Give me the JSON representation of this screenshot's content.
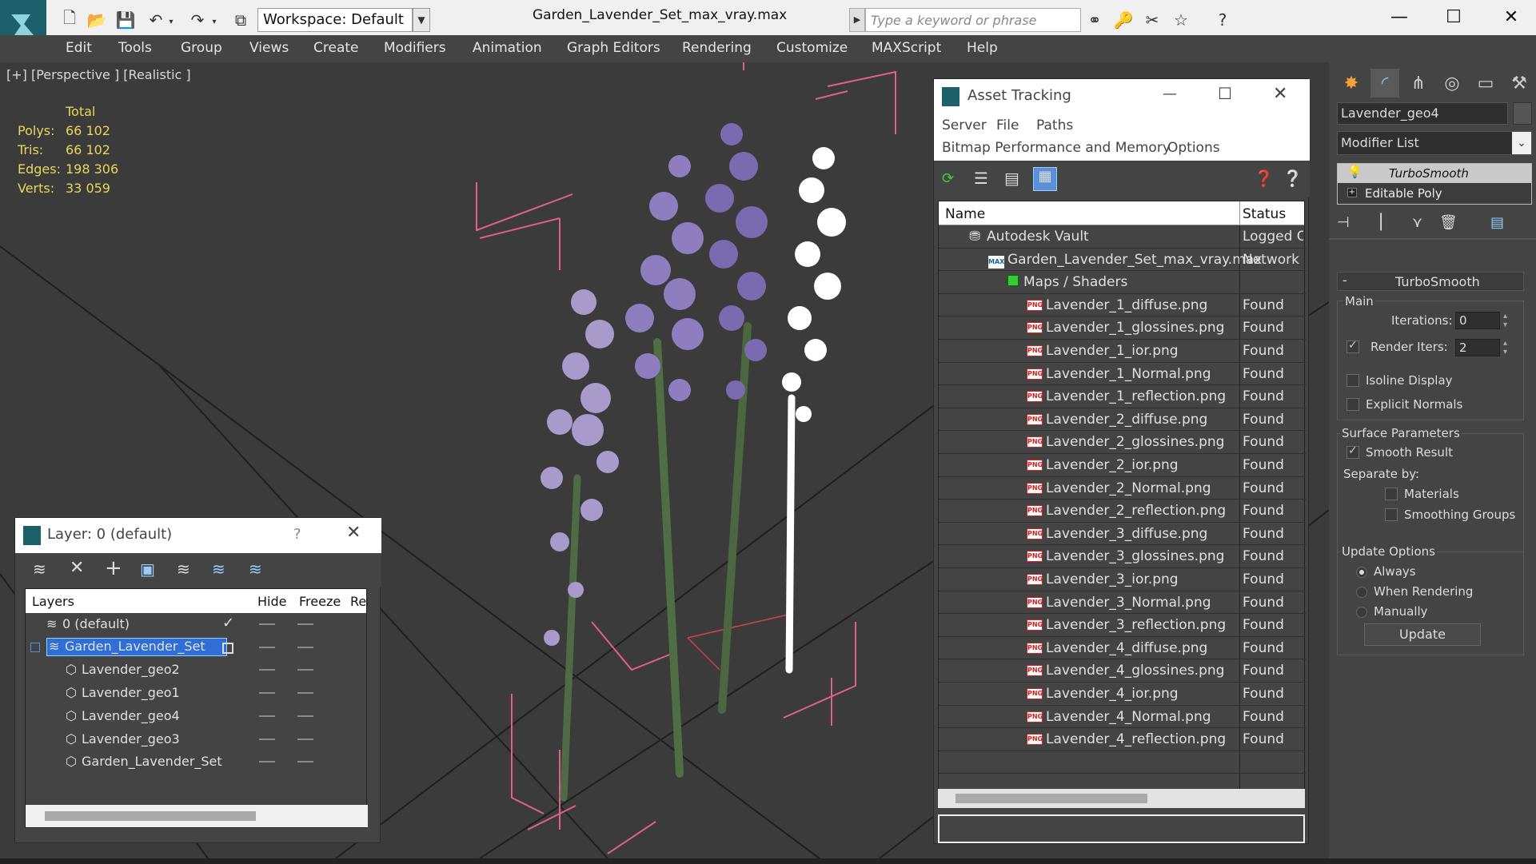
{
  "titlebar": {
    "workspace": "Workspace: Default",
    "document_title": "Garden_Lavender_Set_max_vray.max",
    "search_placeholder": "Type a keyword or phrase"
  },
  "menu": [
    "Edit",
    "Tools",
    "Group",
    "Views",
    "Create",
    "Modifiers",
    "Animation",
    "Graph Editors",
    "Rendering",
    "Customize",
    "MAXScript",
    "Help"
  ],
  "viewport": {
    "label": "[+] [Perspective ] [Realistic ]",
    "stats_header": "Total",
    "stats": [
      {
        "label": "Polys:",
        "value": "66 102"
      },
      {
        "label": "Tris:",
        "value": "66 102"
      },
      {
        "label": "Edges:",
        "value": "198 306"
      },
      {
        "label": "Verts:",
        "value": "33 059"
      }
    ]
  },
  "asset_tracking": {
    "title": "Asset Tracking",
    "menu": [
      "Server",
      "File",
      "Paths",
      "Bitmap Performance and Memory",
      "Options"
    ],
    "columns": [
      "Name",
      "Status"
    ],
    "rows": [
      {
        "name": "Autodesk Vault",
        "status": "Logged Out",
        "indent": 0,
        "icon": "vault"
      },
      {
        "name": "Garden_Lavender_Set_max_vray.max",
        "status": "Network",
        "indent": 1,
        "icon": "max"
      },
      {
        "name": "Maps / Shaders",
        "status": "",
        "indent": 2,
        "icon": "maps"
      },
      {
        "name": "Lavender_1_diffuse.png",
        "status": "Found",
        "indent": 3,
        "icon": "png"
      },
      {
        "name": "Lavender_1_glossines.png",
        "status": "Found",
        "indent": 3,
        "icon": "png"
      },
      {
        "name": "Lavender_1_ior.png",
        "status": "Found",
        "indent": 3,
        "icon": "png"
      },
      {
        "name": "Lavender_1_Normal.png",
        "status": "Found",
        "indent": 3,
        "icon": "png"
      },
      {
        "name": "Lavender_1_reflection.png",
        "status": "Found",
        "indent": 3,
        "icon": "png"
      },
      {
        "name": "Lavender_2_diffuse.png",
        "status": "Found",
        "indent": 3,
        "icon": "png"
      },
      {
        "name": "Lavender_2_glossines.png",
        "status": "Found",
        "indent": 3,
        "icon": "png"
      },
      {
        "name": "Lavender_2_ior.png",
        "status": "Found",
        "indent": 3,
        "icon": "png"
      },
      {
        "name": "Lavender_2_Normal.png",
        "status": "Found",
        "indent": 3,
        "icon": "png"
      },
      {
        "name": "Lavender_2_reflection.png",
        "status": "Found",
        "indent": 3,
        "icon": "png"
      },
      {
        "name": "Lavender_3_diffuse.png",
        "status": "Found",
        "indent": 3,
        "icon": "png"
      },
      {
        "name": "Lavender_3_glossines.png",
        "status": "Found",
        "indent": 3,
        "icon": "png"
      },
      {
        "name": "Lavender_3_ior.png",
        "status": "Found",
        "indent": 3,
        "icon": "png"
      },
      {
        "name": "Lavender_3_Normal.png",
        "status": "Found",
        "indent": 3,
        "icon": "png"
      },
      {
        "name": "Lavender_3_reflection.png",
        "status": "Found",
        "indent": 3,
        "icon": "png"
      },
      {
        "name": "Lavender_4_diffuse.png",
        "status": "Found",
        "indent": 3,
        "icon": "png"
      },
      {
        "name": "Lavender_4_glossines.png",
        "status": "Found",
        "indent": 3,
        "icon": "png"
      },
      {
        "name": "Lavender_4_ior.png",
        "status": "Found",
        "indent": 3,
        "icon": "png"
      },
      {
        "name": "Lavender_4_Normal.png",
        "status": "Found",
        "indent": 3,
        "icon": "png"
      },
      {
        "name": "Lavender_4_reflection.png",
        "status": "Found",
        "indent": 3,
        "icon": "png"
      }
    ]
  },
  "layer_panel": {
    "title": "Layer: 0 (default)",
    "help": "?",
    "columns": [
      "Layers",
      "Hide",
      "Freeze",
      "Ren"
    ],
    "rows": [
      {
        "name": "0 (default)",
        "indent": 1,
        "type": "layer",
        "current": true
      },
      {
        "name": "Garden_Lavender_Set",
        "indent": 1,
        "type": "layer",
        "selected": true
      },
      {
        "name": "Lavender_geo2",
        "indent": 2,
        "type": "object"
      },
      {
        "name": "Lavender_geo1",
        "indent": 2,
        "type": "object"
      },
      {
        "name": "Lavender_geo4",
        "indent": 2,
        "type": "object"
      },
      {
        "name": "Lavender_geo3",
        "indent": 2,
        "type": "object"
      },
      {
        "name": "Garden_Lavender_Set",
        "indent": 2,
        "type": "object"
      }
    ]
  },
  "command_panel": {
    "object_name": "Lavender_geo4",
    "modifier_list": "Modifier List",
    "stack": [
      "TurboSmooth",
      "Editable Poly"
    ],
    "rollout_title": "TurboSmooth",
    "main_label": "Main",
    "iterations_label": "Iterations:",
    "iterations_value": "0",
    "render_iters_label": "Render Iters:",
    "render_iters_value": "2",
    "isoline_display": "Isoline Display",
    "explicit_normals": "Explicit Normals",
    "surface_parameters": "Surface Parameters",
    "smooth_result": "Smooth Result",
    "separate_by": "Separate by:",
    "materials": "Materials",
    "smoothing_groups": "Smoothing Groups",
    "update_options": "Update Options",
    "always": "Always",
    "when_rendering": "When Rendering",
    "manually": "Manually",
    "update_button": "Update"
  }
}
